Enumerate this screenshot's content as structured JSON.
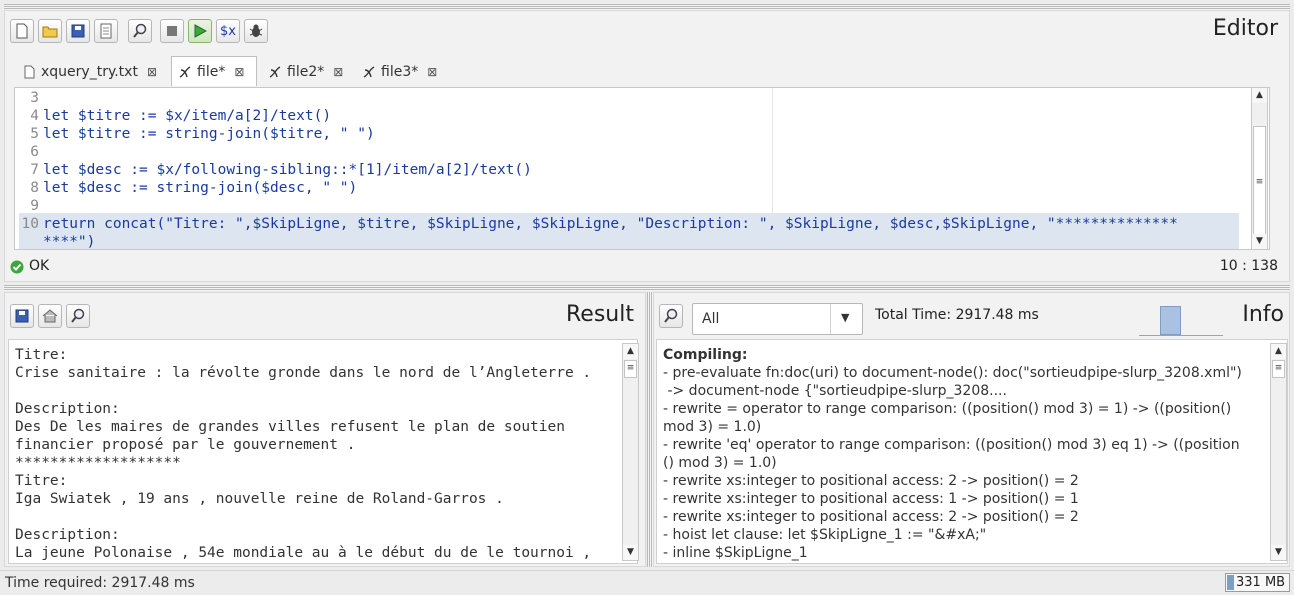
{
  "editor": {
    "title": "Editor",
    "toolbar": [
      {
        "name": "new-file-icon",
        "glyph": "🗋"
      },
      {
        "name": "open-folder-icon",
        "glyph": "📂"
      },
      {
        "name": "save-icon",
        "glyph": "💾"
      },
      {
        "name": "properties-icon",
        "glyph": "▤"
      },
      {
        "name": "find-icon",
        "glyph": "🔍"
      },
      {
        "name": "stop-icon",
        "glyph": "■"
      },
      {
        "name": "run-icon",
        "glyph": "▶"
      },
      {
        "name": "variables-icon",
        "glyph": "$x"
      },
      {
        "name": "debug-icon",
        "glyph": "🐞"
      }
    ],
    "tabs": [
      {
        "label": "xquery_try.txt",
        "close": "⊠"
      },
      {
        "label": "file*",
        "close": "⊠"
      },
      {
        "label": "file2*",
        "close": "⊠"
      },
      {
        "label": "file3*",
        "close": "⊠"
      }
    ],
    "line_numbers": [
      "3",
      "4",
      "5",
      "6",
      "7",
      "8",
      "9",
      "10"
    ],
    "code": {
      "l4": "let $titre := $x/item/a[2]/text()",
      "l5": "let $titre := string-join($titre, \" \")",
      "l7": "let $desc := $x/following-sibling::*[1]/item/a[2]/text()",
      "l8": "let $desc := string-join($desc, \" \")",
      "l10": "return concat(\"Titre: \",$SkipLigne, $titre, $SkipLigne, $SkipLigne, \"Description: \", $SkipLigne, $desc,$SkipLigne, \"**************",
      "l10b": "****\")"
    },
    "status": "OK",
    "position": "10 : 138"
  },
  "result": {
    "title": "Result",
    "lines": [
      "Titre:",
      "Crise sanitaire : la révolte gronde dans le nord de l’Angleterre .",
      "",
      "Description:",
      "Des De les maires de grandes villes refusent le plan de soutien",
      "financier proposé par le gouvernement .",
      "*******************",
      "Titre:",
      "Iga Swiatek , 19 ans , nouvelle reine de Roland-Garros .",
      "",
      "Description:",
      "La jeune Polonaise , 54e mondiale au à le début du de le tournoi ,"
    ]
  },
  "info": {
    "title": "Info",
    "filter_selected": "All",
    "total_time": "Total Time: 2917.48 ms",
    "lines": [
      "Compiling:",
      "- pre-evaluate fn:doc(uri) to document-node(): doc(\"sortieudpipe-slurp_3208.xml\")",
      " -> document-node {\"sortieudpipe-slurp_3208....",
      "- rewrite = operator to range comparison: ((position() mod 3) = 1) -> ((position()",
      "mod 3) = 1.0)",
      "- rewrite 'eq' operator to range comparison: ((position() mod 3) eq 1) -> ((position",
      "() mod 3) = 1.0)",
      "- rewrite xs:integer to positional access: 2 -> position() = 2",
      "- rewrite xs:integer to positional access: 1 -> position() = 1",
      "- rewrite xs:integer to positional access: 2 -> position() = 2",
      "- hoist let clause: let $SkipLigne_1 := \"&#xA;\"",
      "- inline $SkipLigne_1"
    ]
  },
  "statusbar": {
    "time_required": "Time required: 2917.48 ms",
    "memory": "331 MB"
  }
}
